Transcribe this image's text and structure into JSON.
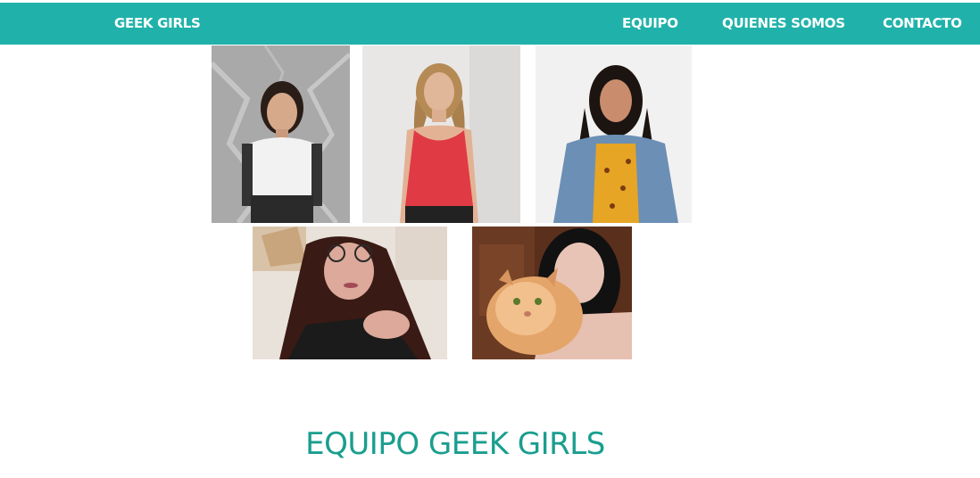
{
  "navbar": {
    "brand": "GEEK GIRLS",
    "links": [
      "EQUIPO",
      "QUIENES SOMOS",
      "CONTACTO"
    ],
    "color": "#20b2aa"
  },
  "team": {
    "photos": [
      {
        "alt": "team-member-photo-1"
      },
      {
        "alt": "team-member-photo-2"
      },
      {
        "alt": "team-member-photo-3"
      },
      {
        "alt": "team-member-photo-4"
      },
      {
        "alt": "team-member-photo-5"
      }
    ],
    "title": "EQUIPO GEEK GIRLS",
    "title_color": "#1a9e8f"
  }
}
